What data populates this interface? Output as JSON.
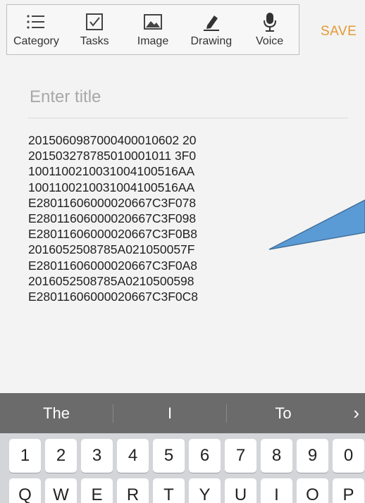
{
  "toolbar": {
    "items": [
      {
        "label": "Category",
        "icon": "list-icon"
      },
      {
        "label": "Tasks",
        "icon": "checkbox-icon"
      },
      {
        "label": "Image",
        "icon": "image-icon"
      },
      {
        "label": "Drawing",
        "icon": "pen-icon"
      },
      {
        "label": "Voice",
        "icon": "microphone-icon"
      }
    ],
    "save_label": "SAVE"
  },
  "editor": {
    "title_placeholder": "Enter title",
    "lines": [
      "2015060987000400010602 20",
      "201503278785010001011 3F0",
      "1001100210031004100516AA",
      "1001100210031004100516AA",
      "E28011606000020667C3F078",
      "E28011606000020667C3F098",
      "E28011606000020667C3F0B8",
      "2016052508785A021050057F",
      "E28011606000020667C3F0A8",
      "2016052508785A0210500598",
      "E28011606000020667C3F0C8"
    ]
  },
  "keyboard": {
    "suggestions": [
      "The",
      "I",
      "To"
    ],
    "next_icon": "chevron-right-icon",
    "number_row": [
      "1",
      "2",
      "3",
      "4",
      "5",
      "6",
      "7",
      "8",
      "9",
      "0"
    ],
    "letter_row": [
      "Q",
      "W",
      "E",
      "R",
      "T",
      "Y",
      "U",
      "I",
      "O",
      "P"
    ]
  },
  "colors": {
    "accent": "#e39a33",
    "callout_fill": "#5b9bd5",
    "suggestion_bar": "#6b6b6b",
    "keyboard_bg": "#d3d5d9"
  }
}
